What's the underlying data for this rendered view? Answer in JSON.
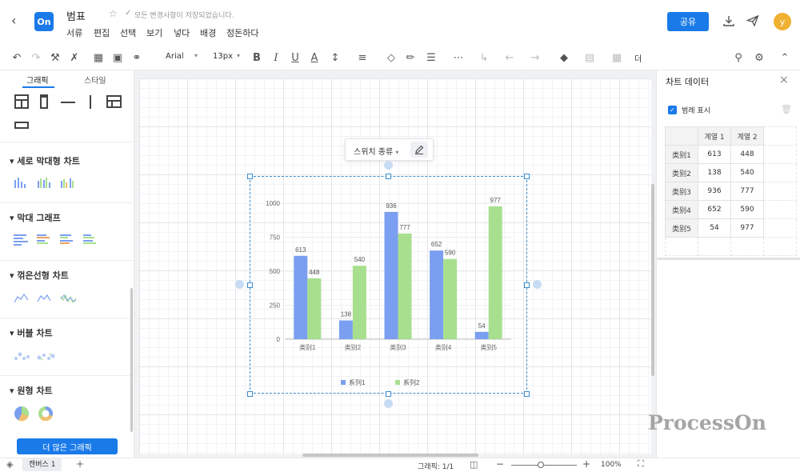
{
  "app": {
    "logo_text": "On",
    "doc_title": "범표",
    "save_status": "모든 변경사항이 저장되었습니다.",
    "share_label": "공유",
    "avatar_letter": "y",
    "accent": "#1a7ae8"
  },
  "menu": [
    "서류",
    "편집",
    "선택",
    "보기",
    "넣다",
    "배경",
    "정돈하다"
  ],
  "toolbar": {
    "font_family": "Arial",
    "font_size": "13px",
    "more_label": "더"
  },
  "left_panel": {
    "tabs": [
      "그래픽",
      "스타일"
    ],
    "sections": [
      {
        "title": "세로 막대형 차트"
      },
      {
        "title": "막대 그래프"
      },
      {
        "title": "꺾은선형 차트"
      },
      {
        "title": "버블 차트"
      },
      {
        "title": "원형 차트"
      }
    ],
    "more_button": "더 많은 그래픽"
  },
  "floating": {
    "switch_type": "스위치 종류"
  },
  "chart_data": {
    "type": "bar",
    "categories": [
      "类别1",
      "类别2",
      "类别3",
      "类别4",
      "类别5"
    ],
    "series": [
      {
        "name": "系列1",
        "values": [
          613,
          138,
          936,
          652,
          54
        ],
        "color": "#7b9ff0"
      },
      {
        "name": "系列2",
        "values": [
          448,
          540,
          777,
          590,
          977
        ],
        "color": "#a8df8e"
      }
    ],
    "yticks": [
      "0",
      "250",
      "500",
      "750",
      "1000"
    ],
    "ylim": [
      0,
      1000
    ],
    "grid": true,
    "legend": "bottom",
    "data_labels": true
  },
  "right_panel": {
    "title": "차트 데이터",
    "legend_checkbox_label": "범례 표시",
    "legend_checked": true,
    "table": {
      "headers": [
        "계열 1",
        "계열 2"
      ],
      "rows": [
        {
          "label": "类别1",
          "v1": "613",
          "v2": "448"
        },
        {
          "label": "类别2",
          "v1": "138",
          "v2": "540"
        },
        {
          "label": "类别3",
          "v1": "936",
          "v2": "777"
        },
        {
          "label": "类别4",
          "v1": "652",
          "v2": "590"
        },
        {
          "label": "类别5",
          "v1": "54",
          "v2": "977"
        }
      ]
    }
  },
  "status": {
    "canvas_tab": "캔버스 1",
    "graphic_count": "그래픽: 1/1",
    "zoom": "100%"
  },
  "watermark": "ProcessOn"
}
